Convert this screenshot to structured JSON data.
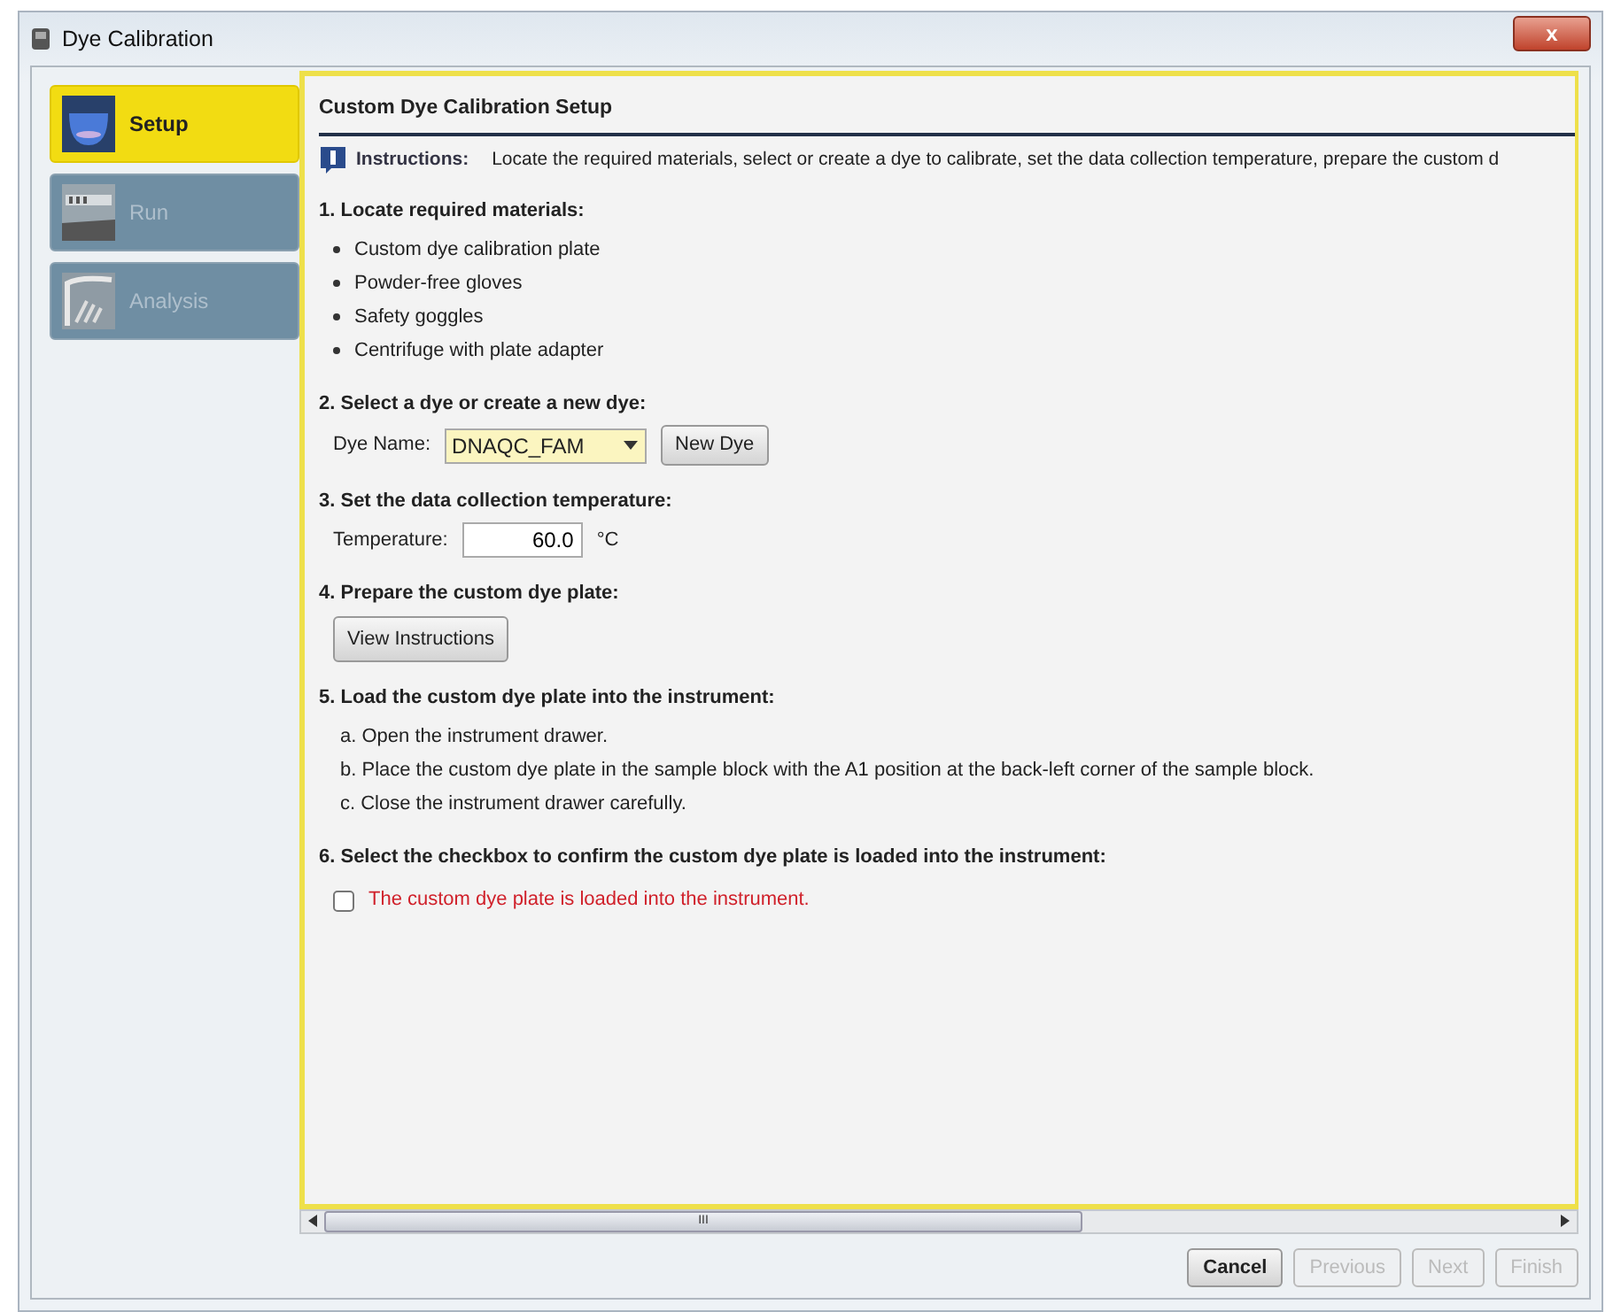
{
  "window": {
    "title": "Dye Calibration",
    "close": "x"
  },
  "sidebar": {
    "items": [
      {
        "label": "Setup",
        "kind": "setup",
        "selected": true
      },
      {
        "label": "Run",
        "kind": "run",
        "selected": false
      },
      {
        "label": "Analysis",
        "kind": "analysis",
        "selected": false
      }
    ]
  },
  "panel": {
    "title": "Custom Dye Calibration Setup",
    "instructions_label": "Instructions:",
    "instructions": "Locate the required materials, select or create a dye to calibrate, set the data collection temperature, prepare the custom d",
    "step1": {
      "heading": "1. Locate required materials:",
      "items": [
        "Custom dye calibration plate",
        "Powder-free gloves",
        "Safety goggles",
        "Centrifuge with plate adapter"
      ]
    },
    "step2": {
      "heading": "2. Select a dye or create a new dye:",
      "label": "Dye Name:",
      "value": "DNAQC_FAM",
      "button": "New Dye"
    },
    "step3": {
      "heading": "3. Set the data collection temperature:",
      "label": "Temperature:",
      "value": "60.0",
      "unit": "°C"
    },
    "step4": {
      "heading": "4. Prepare the custom dye plate:",
      "button": "View Instructions"
    },
    "step5": {
      "heading": "5. Load the custom dye plate into the instrument:",
      "items": [
        "a. Open the instrument drawer.",
        "b. Place the custom dye plate in the sample block with the A1 position at the back-left corner of the sample block.",
        "c. Close the instrument drawer carefully."
      ]
    },
    "step6": {
      "heading": "6. Select the checkbox to confirm the custom dye plate is loaded into the instrument:",
      "checkbox": {
        "label": "The custom dye plate is loaded into the instrument.",
        "checked": false
      }
    }
  },
  "scrollbar": {
    "grip": "III"
  },
  "footer": {
    "buttons": [
      {
        "label": "Cancel",
        "disabled": false
      },
      {
        "label": "Previous",
        "disabled": true
      },
      {
        "label": "Next",
        "disabled": true
      },
      {
        "label": "Finish",
        "disabled": true
      }
    ]
  }
}
